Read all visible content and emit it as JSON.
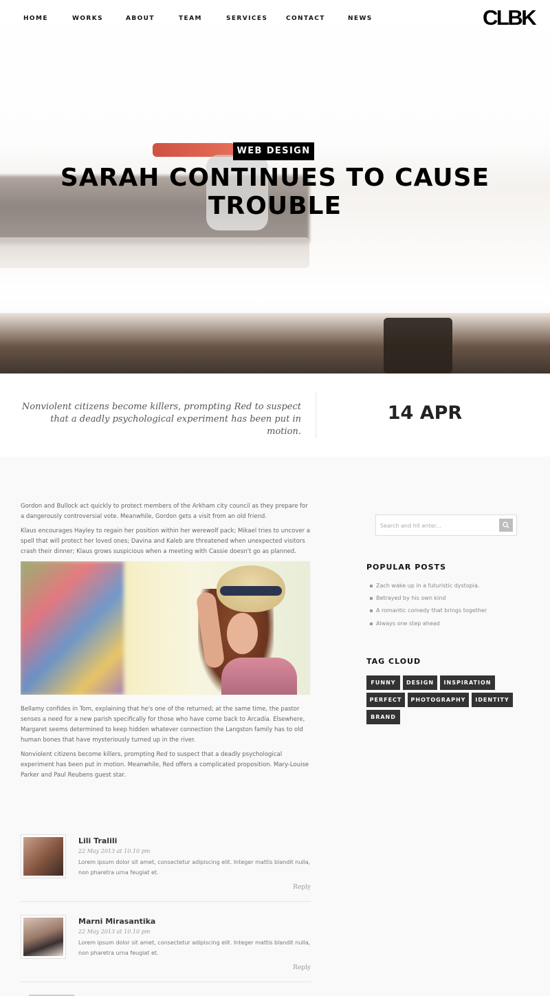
{
  "nav": {
    "items": [
      {
        "label": "HOME"
      },
      {
        "label": "WORKS"
      },
      {
        "label": "ABOUT"
      },
      {
        "label": "TEAM"
      },
      {
        "label": "SERVICES"
      },
      {
        "label": "CONTACT"
      },
      {
        "label": "NEWS"
      }
    ],
    "logo": "CLBK"
  },
  "hero": {
    "category": "WEB DESIGN",
    "title": "SARAH CONTINUES TO CAUSE TROUBLE"
  },
  "meta": {
    "quote": "Nonviolent citizens become killers, prompting Red to suspect that a deadly psychological experiment has been put in motion.",
    "date": "14 APR"
  },
  "article": {
    "paragraphs": [
      "Gordon and Bullock act quickly to protect members of the Arkham city council as they prepare for a dangerously controversial vote. Meanwhile, Gordon gets a visit from an old friend.",
      "Klaus encourages Hayley to regain her position within her werewolf pack; Mikael tries to uncover a spell that will protect her loved ones; Davina and Kaleb are threatened when unexpected visitors crash their dinner; Klaus grows suspicious when a meeting with Cassie doesn't go as planned.",
      "Bellamy confides in Tom, explaining that he's one of the returned; at the same time, the pastor senses a need for a new parish specifically for those who have come back to Arcadia. Elsewhere, Margaret seems determined to keep hidden whatever connection the Langston family has to old human bones that have mysteriously turned up in the river.",
      "Nonviolent citizens become killers, prompting Red to suspect that a deadly psychological experiment has been put in motion. Meanwhile, Red offers a complicated proposition. Mary-Louise Parker and Paul Reubens guest star."
    ]
  },
  "sidebar": {
    "search_placeholder": "Search and hit enter...",
    "popular_title": "POPULAR POSTS",
    "popular_posts": [
      "Zach wake up in a futuristic dystopia.",
      "Betrayed by his own kind",
      "A romantic comedy that brings together",
      "Always one step ahead"
    ],
    "tags_title": "TAG CLOUD",
    "tags": [
      "FUNNY",
      "DESIGN",
      "INSPIRATION",
      "PERFECT",
      "PHOTOGRAPHY",
      "IDENTITY",
      "BRAND"
    ]
  },
  "comments": [
    {
      "name": "Lili Tralili",
      "date": "22 May 2013 at 10.10 pm",
      "text": "Lorem ipsum dolor sit amet, consectetur adipiscing elit. Integer mattis blandit nulla, non pharetra urna feugiat et.",
      "reply": "Reply"
    },
    {
      "name": "Marni Mirasantika",
      "date": "22 May 2013 at 10.10 pm",
      "text": "Lorem ipsum dolor sit amet, consectetur adipiscing elit. Integer mattis blandit nulla, non pharetra urna feugiat et.",
      "reply": "Reply"
    }
  ]
}
